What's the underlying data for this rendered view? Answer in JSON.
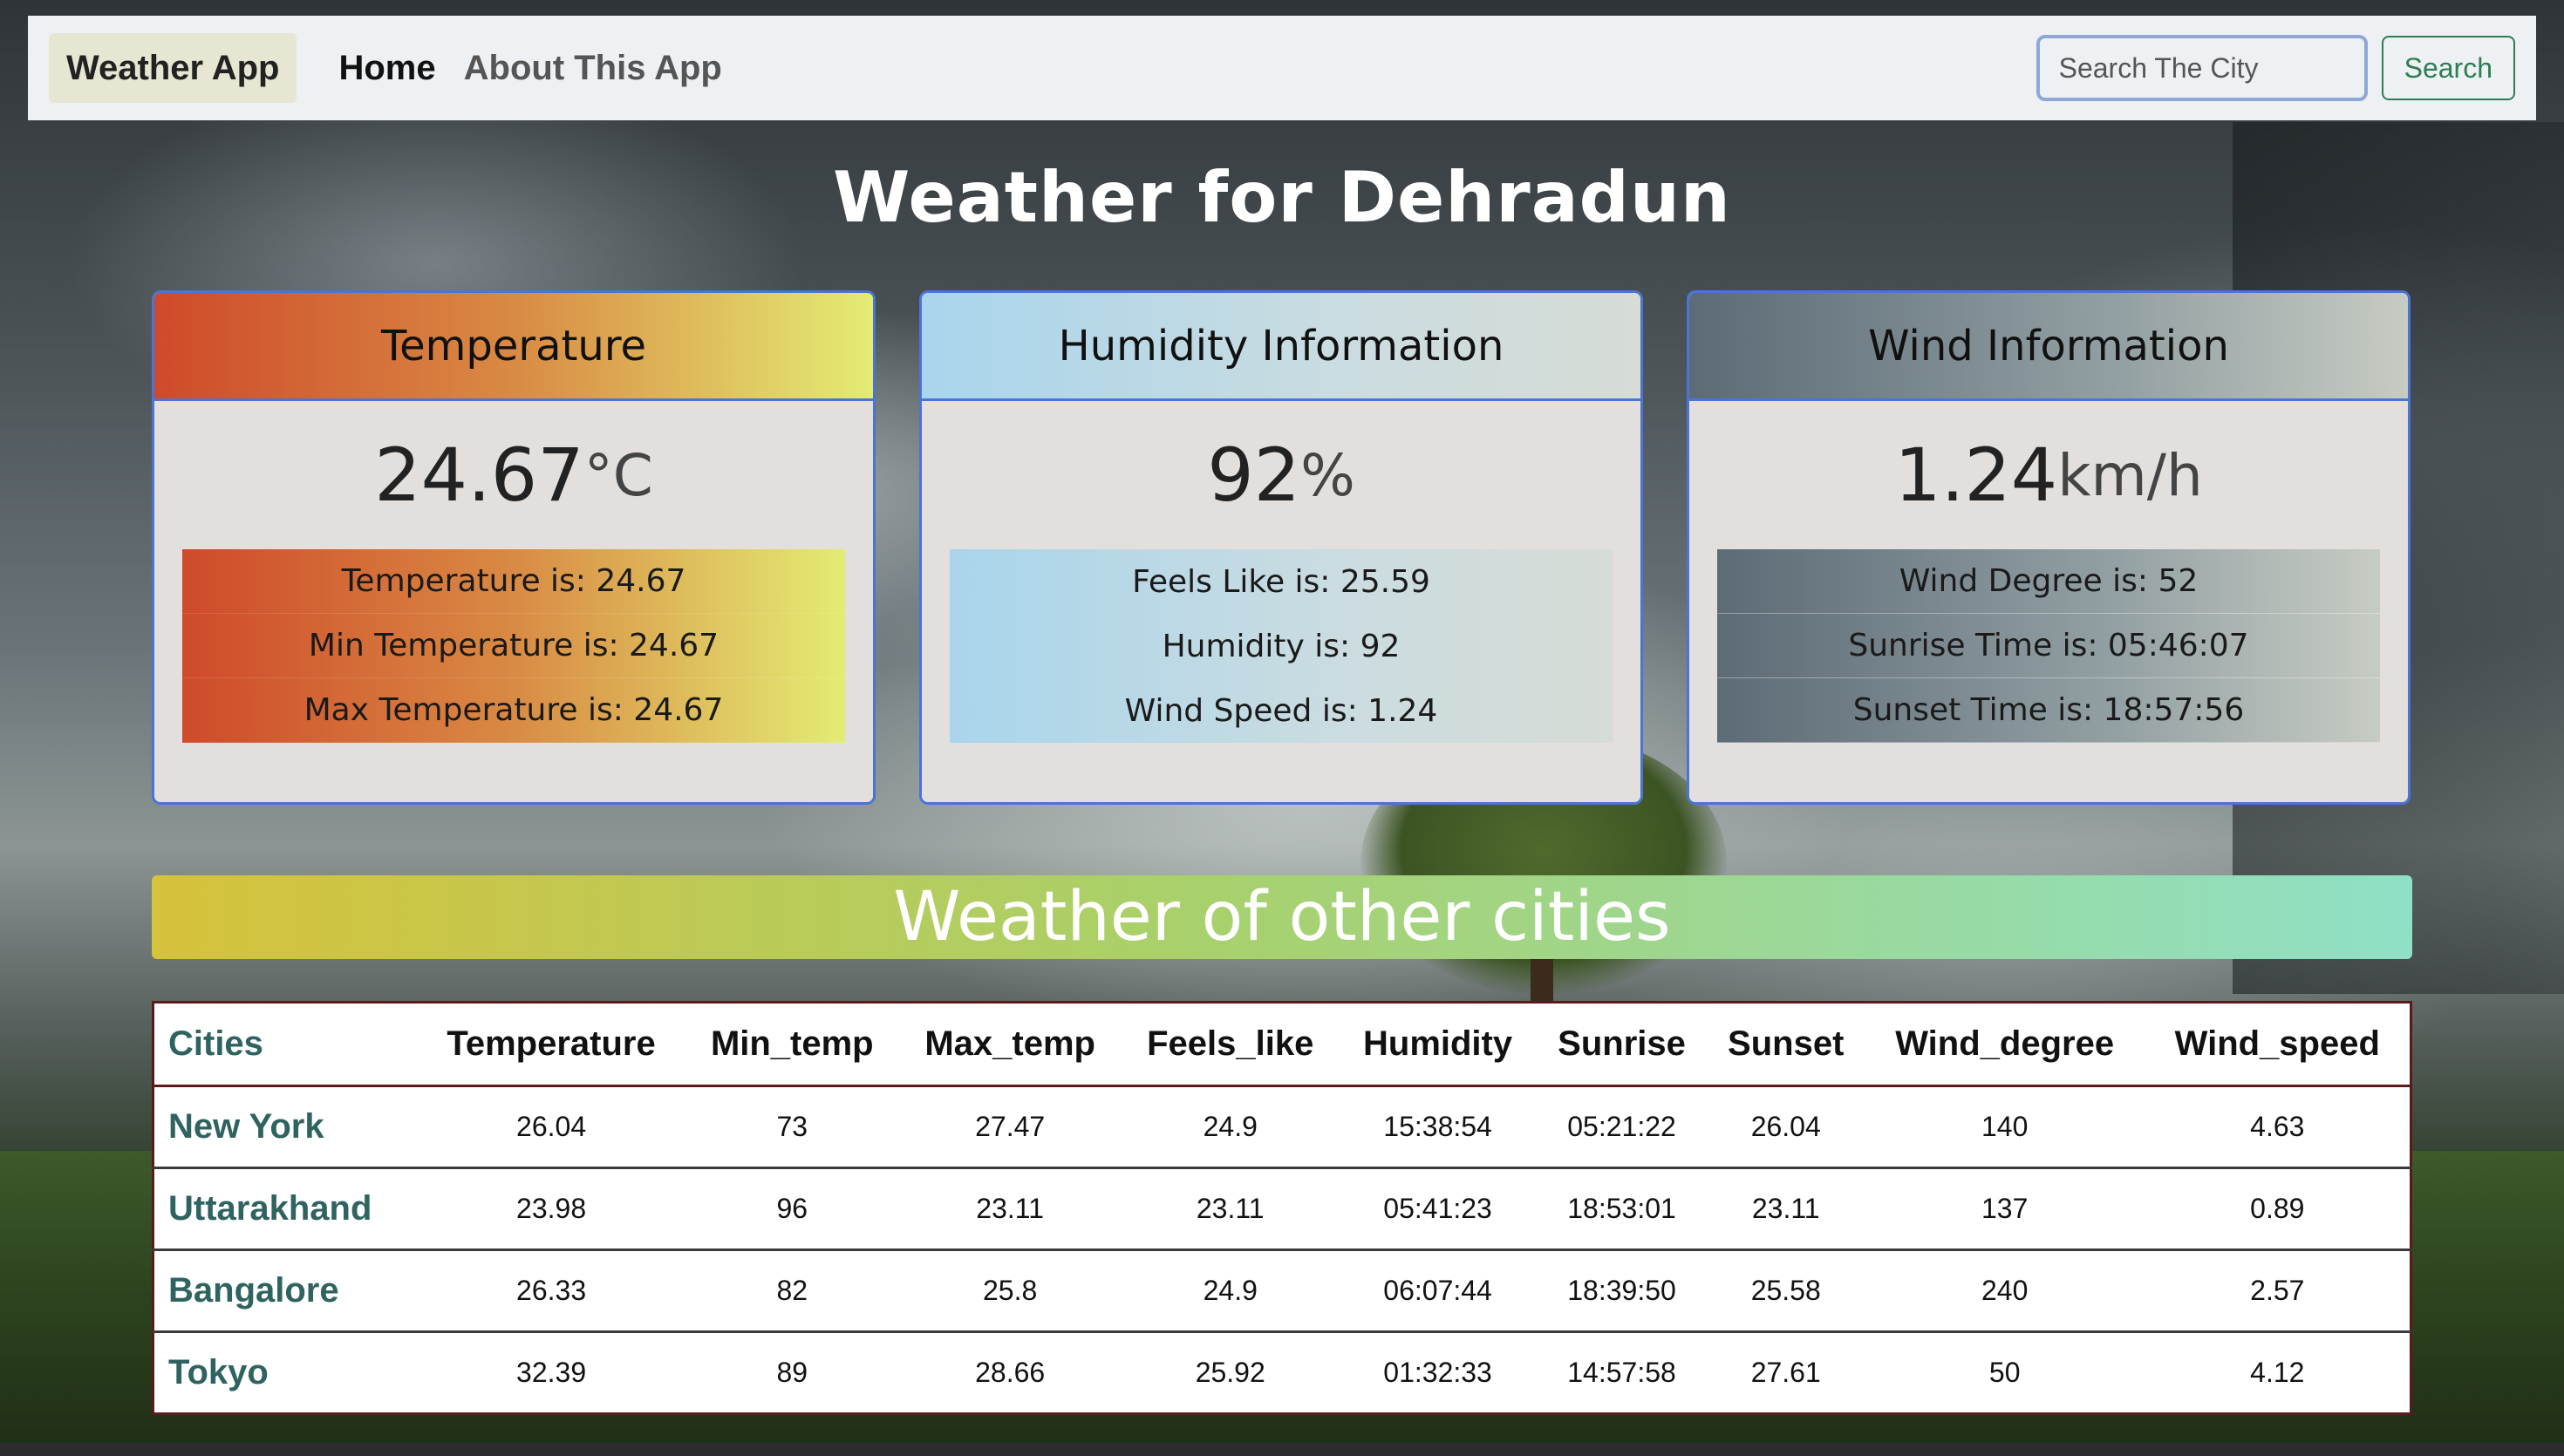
{
  "navbar": {
    "brand": "Weather App",
    "links": [
      "Home",
      "About This App"
    ],
    "search_placeholder": "Search The City",
    "search_button": "Search"
  },
  "headline": "Weather for Dehradun",
  "cards": {
    "temperature": {
      "title": "Temperature",
      "value": "24.67",
      "unit": "°C",
      "rows": [
        "Temperature is: 24.67",
        "Min Temperature is: 24.67",
        "Max Temperature is: 24.67"
      ]
    },
    "humidity": {
      "title": "Humidity Information",
      "value": "92",
      "unit": "%",
      "rows": [
        "Feels Like is: 25.59",
        "Humidity is: 92",
        "Wind Speed is: 1.24"
      ]
    },
    "wind": {
      "title": "Wind Information",
      "value": "1.24",
      "unit": "km/h",
      "rows": [
        "Wind Degree is: 52",
        "Sunrise Time is: 05:46:07",
        "Sunset Time is: 18:57:56"
      ]
    }
  },
  "other_cities": {
    "banner": "Weather of other cities",
    "columns": [
      "Cities",
      "Temperature",
      "Min_temp",
      "Max_temp",
      "Feels_like",
      "Humidity",
      "Sunrise",
      "Sunset",
      "Wind_degree",
      "Wind_speed"
    ],
    "rows": [
      [
        "New York",
        "26.04",
        "73",
        "27.47",
        "24.9",
        "15:38:54",
        "05:21:22",
        "26.04",
        "140",
        "4.63"
      ],
      [
        "Uttarakhand",
        "23.98",
        "96",
        "23.11",
        "23.11",
        "05:41:23",
        "18:53:01",
        "23.11",
        "137",
        "0.89"
      ],
      [
        "Bangalore",
        "26.33",
        "82",
        "25.8",
        "24.9",
        "06:07:44",
        "18:39:50",
        "25.58",
        "240",
        "2.57"
      ],
      [
        "Tokyo",
        "32.39",
        "89",
        "28.66",
        "25.92",
        "01:32:33",
        "14:57:58",
        "27.61",
        "50",
        "4.12"
      ]
    ]
  },
  "colors": {
    "card_border": "#4a74d6",
    "search_green": "#2e7d53",
    "city_teal": "#2f6360"
  }
}
